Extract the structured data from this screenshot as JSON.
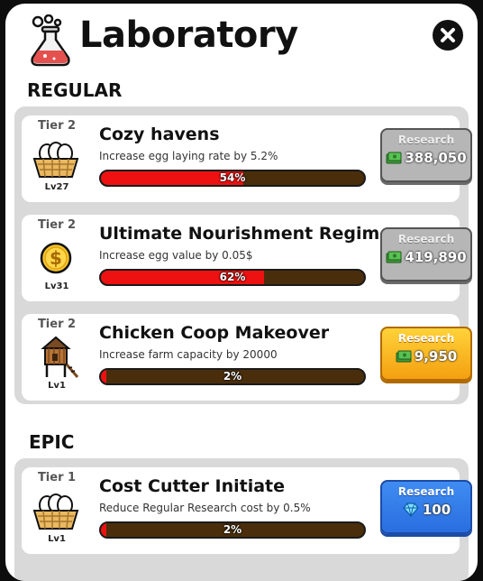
{
  "header": {
    "title": "Laboratory",
    "icon": "flask-icon",
    "close_icon": "close-icon"
  },
  "sections": {
    "regular_label": "REGULAR",
    "epic_label": "EPIC"
  },
  "regular_items": [
    {
      "tier": "Tier 2",
      "icon": "eggs-basket-icon",
      "level": "Lv27",
      "name": "Cozy havens",
      "description": "Increase egg laying rate by 5.2%",
      "progress_text": "54%",
      "progress": 0.54,
      "button_label": "Research",
      "cost": "388,050",
      "currency_icon": "cash-icon",
      "button_state": "disabled"
    },
    {
      "tier": "Tier 2",
      "icon": "dollar-coin-icon",
      "level": "Lv31",
      "name": "Ultimate Nourishment Regimen",
      "description": "Increase egg value by 0.05$",
      "progress_text": "62%",
      "progress": 0.62,
      "button_label": "Research",
      "cost": "419,890",
      "currency_icon": "cash-icon",
      "button_state": "disabled"
    },
    {
      "tier": "Tier 2",
      "icon": "chicken-coop-icon",
      "level": "Lv1",
      "name": "Chicken Coop Makeover",
      "description": "Increase farm capacity by 20000",
      "progress_text": "2%",
      "progress": 0.02,
      "button_label": "Research",
      "cost": "9,950",
      "currency_icon": "cash-icon",
      "button_state": "available"
    }
  ],
  "epic_items": [
    {
      "tier": "Tier 1",
      "icon": "eggs-basket-icon",
      "level": "Lv1",
      "name": "Cost Cutter Initiate",
      "description": "Reduce Regular Research cost by 0.5%",
      "progress_text": "2%",
      "progress": 0.02,
      "button_label": "Research",
      "cost": "100",
      "currency_icon": "gem-icon",
      "button_state": "available"
    }
  ],
  "colors": {
    "progress_fill": "#ee1111",
    "progress_track": "#4a2e0c",
    "button_disabled": "#b6b6b6",
    "button_available": "#f4a010",
    "button_premium": "#2a6ee0"
  }
}
